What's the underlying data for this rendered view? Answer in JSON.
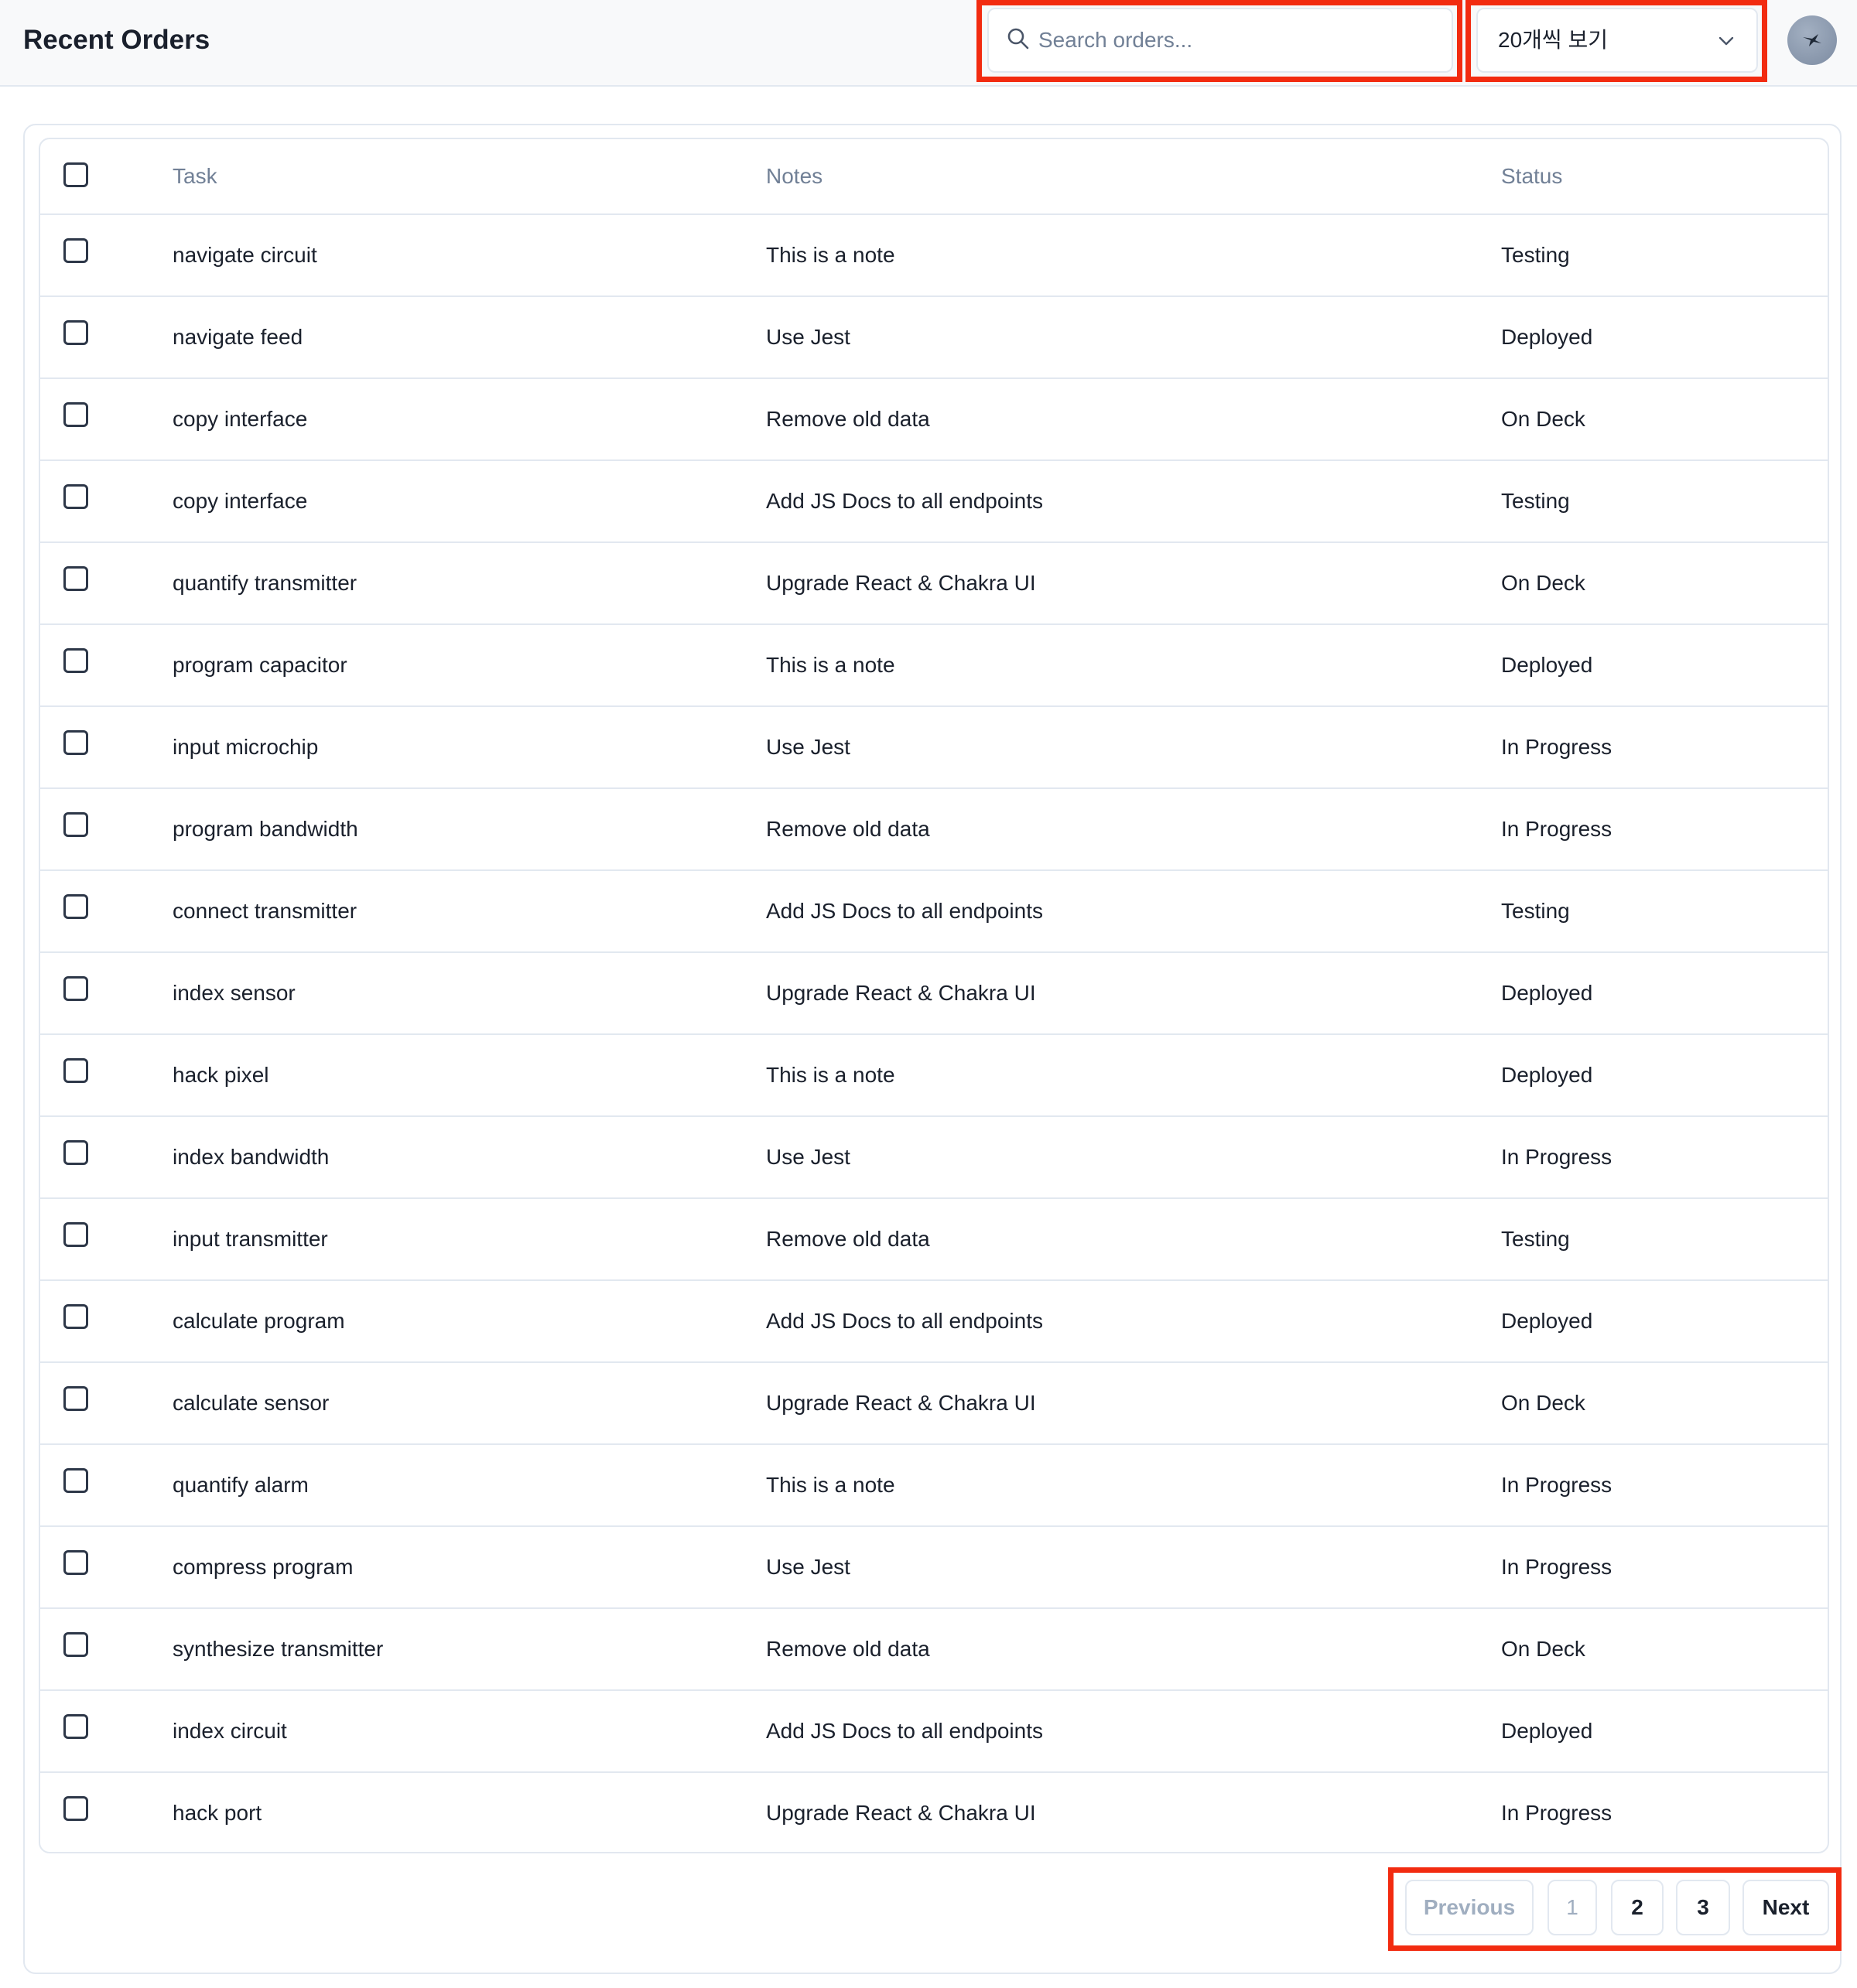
{
  "header": {
    "title": "Recent Orders",
    "search_placeholder": "Search orders...",
    "page_size_selected": "20개씩 보기"
  },
  "colors": {
    "highlight_border": "#f22b10",
    "border": "#e2e8f0",
    "muted_text": "#718096"
  },
  "table": {
    "columns": [
      "Task",
      "Notes",
      "Status"
    ],
    "rows": [
      {
        "task": "navigate circuit",
        "notes": "This is a note",
        "status": "Testing"
      },
      {
        "task": "navigate feed",
        "notes": "Use Jest",
        "status": "Deployed"
      },
      {
        "task": "copy interface",
        "notes": "Remove old data",
        "status": "On Deck"
      },
      {
        "task": "copy interface",
        "notes": "Add JS Docs to all endpoints",
        "status": "Testing"
      },
      {
        "task": "quantify transmitter",
        "notes": "Upgrade React & Chakra UI",
        "status": "On Deck"
      },
      {
        "task": "program capacitor",
        "notes": "This is a note",
        "status": "Deployed"
      },
      {
        "task": "input microchip",
        "notes": "Use Jest",
        "status": "In Progress"
      },
      {
        "task": "program bandwidth",
        "notes": "Remove old data",
        "status": "In Progress"
      },
      {
        "task": "connect transmitter",
        "notes": "Add JS Docs to all endpoints",
        "status": "Testing"
      },
      {
        "task": "index sensor",
        "notes": "Upgrade React & Chakra UI",
        "status": "Deployed"
      },
      {
        "task": "hack pixel",
        "notes": "This is a note",
        "status": "Deployed"
      },
      {
        "task": "index bandwidth",
        "notes": "Use Jest",
        "status": "In Progress"
      },
      {
        "task": "input transmitter",
        "notes": "Remove old data",
        "status": "Testing"
      },
      {
        "task": "calculate program",
        "notes": "Add JS Docs to all endpoints",
        "status": "Deployed"
      },
      {
        "task": "calculate sensor",
        "notes": "Upgrade React & Chakra UI",
        "status": "On Deck"
      },
      {
        "task": "quantify alarm",
        "notes": "This is a note",
        "status": "In Progress"
      },
      {
        "task": "compress program",
        "notes": "Use Jest",
        "status": "In Progress"
      },
      {
        "task": "synthesize transmitter",
        "notes": "Remove old data",
        "status": "On Deck"
      },
      {
        "task": "index circuit",
        "notes": "Add JS Docs to all endpoints",
        "status": "Deployed"
      },
      {
        "task": "hack port",
        "notes": "Upgrade React & Chakra UI",
        "status": "In Progress"
      }
    ]
  },
  "pagination": {
    "previous_label": "Previous",
    "pages": [
      "1",
      "2",
      "3"
    ],
    "current_page": "1",
    "next_label": "Next"
  }
}
